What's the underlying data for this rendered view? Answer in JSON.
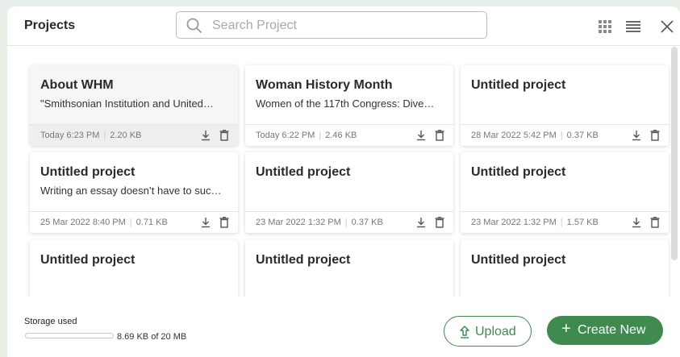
{
  "header": {
    "title": "Projects",
    "search_placeholder": "Search Project"
  },
  "projects": [
    {
      "title": "About WHM",
      "description": "\"Smithsonian Institution and United…",
      "date": "Today 6:23 PM",
      "size": "2.20 KB"
    },
    {
      "title": "Woman History Month",
      "description": "Women of the 117th Congress: Dive…",
      "date": "Today 6:22 PM",
      "size": "2.46 KB"
    },
    {
      "title": "Untitled project",
      "description": "",
      "date": "28 Mar 2022 5:42 PM",
      "size": "0.37 KB"
    },
    {
      "title": "Untitled project",
      "description": "Writing an essay doesn’t have to suc…",
      "date": "25 Mar 2022 8:40 PM",
      "size": "0.71 KB"
    },
    {
      "title": "Untitled project",
      "description": "",
      "date": "23 Mar 2022 1:32 PM",
      "size": "0.37 KB"
    },
    {
      "title": "Untitled project",
      "description": "",
      "date": "23 Mar 2022 1:32 PM",
      "size": "1.57 KB"
    },
    {
      "title": "Untitled project",
      "description": "",
      "date": "",
      "size": ""
    },
    {
      "title": "Untitled project",
      "description": "",
      "date": "",
      "size": ""
    },
    {
      "title": "Untitled project",
      "description": "",
      "date": "",
      "size": ""
    }
  ],
  "footer": {
    "storage_label": "Storage used",
    "storage_text": "8.69 KB of 20 MB",
    "storage_fraction": 0.0004,
    "upload_label": "Upload",
    "create_label": "Create New"
  },
  "icons": {
    "search": "search-icon",
    "grid_view": "grid-view-icon",
    "list_view": "list-view-icon",
    "close": "close-icon",
    "download": "download-icon",
    "delete": "trash-icon",
    "upload": "upload-icon",
    "create": "plus-icon"
  },
  "colors": {
    "accent": "#3e8a4f",
    "background": "#e9efe9"
  }
}
